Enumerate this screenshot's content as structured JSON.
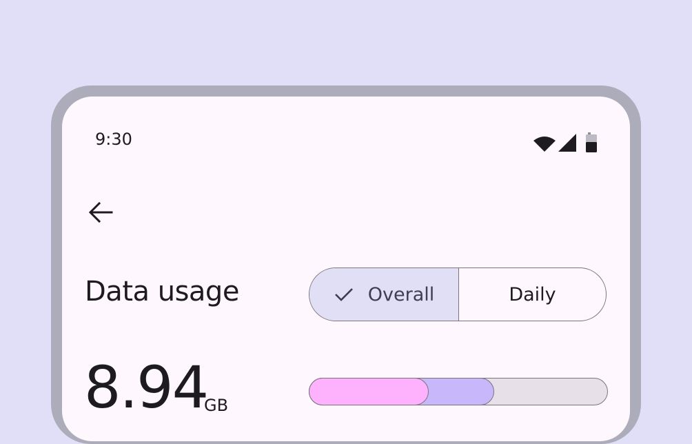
{
  "status_bar": {
    "time": "9:30",
    "icons": [
      "wifi-icon",
      "cellular-signal-icon",
      "battery-icon"
    ]
  },
  "header": {
    "back_icon": "arrow-back-icon",
    "title": "Data usage"
  },
  "segmented_control": {
    "options": [
      {
        "label": "Overall",
        "selected": true,
        "icon": "check-icon"
      },
      {
        "label": "Daily",
        "selected": false
      }
    ]
  },
  "usage": {
    "value": "8.94",
    "unit": "GB",
    "breakdown_fractions": [
      0.4,
      0.62
    ],
    "colors": {
      "segment1": "#feb2fe",
      "segment2": "#c8b8fb",
      "track": "#e7e0e8"
    }
  },
  "colors": {
    "background": "#e1dff7",
    "frame": "#acacba",
    "surface": "#fef7fd",
    "selected_segment": "#e1dff6",
    "outline": "#79747e",
    "on_surface": "#1d1b20"
  }
}
